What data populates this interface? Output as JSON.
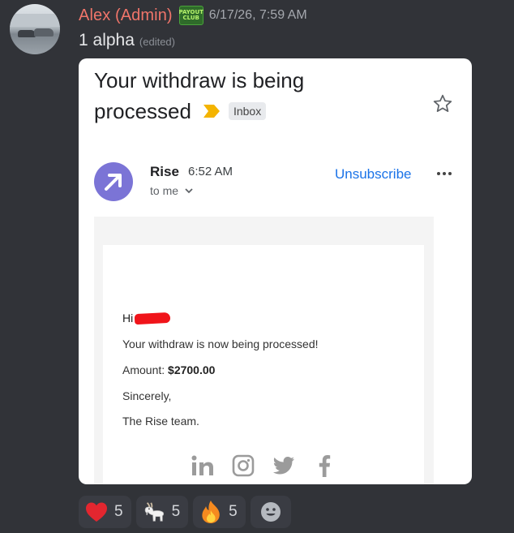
{
  "author": {
    "name": "Alex (Admin)",
    "role_badge": [
      "PAYOUT",
      "CLUB"
    ],
    "timestamp": "6/17/26, 7:59 AM"
  },
  "message": {
    "text": "1 alpha",
    "edited_label": "(edited)"
  },
  "email": {
    "subject_line1": "Your withdraw is being",
    "subject_line2": "processed",
    "label_chip": "Inbox",
    "sender_name": "Rise",
    "sender_time": "6:52 AM",
    "recipient": "to me",
    "unsubscribe_label": "Unsubscribe",
    "greeting": "Hi",
    "body_line1": "Your withdraw is now being processed!",
    "amount_label": "Amount:",
    "amount_value": "$2700.00",
    "signoff": "Sincerely,",
    "signature": "The Rise team.",
    "social_icons": [
      "linkedin-icon",
      "instagram-icon",
      "twitter-icon",
      "facebook-icon"
    ]
  },
  "reactions": [
    {
      "emoji": "heart",
      "count": "5"
    },
    {
      "emoji": "goat",
      "count": "5"
    },
    {
      "emoji": "fire",
      "count": "5"
    }
  ],
  "colors": {
    "background": "#313338",
    "username": "#f0756a",
    "link": "#1a73e8",
    "sender_avatar": "#7b74d6"
  }
}
